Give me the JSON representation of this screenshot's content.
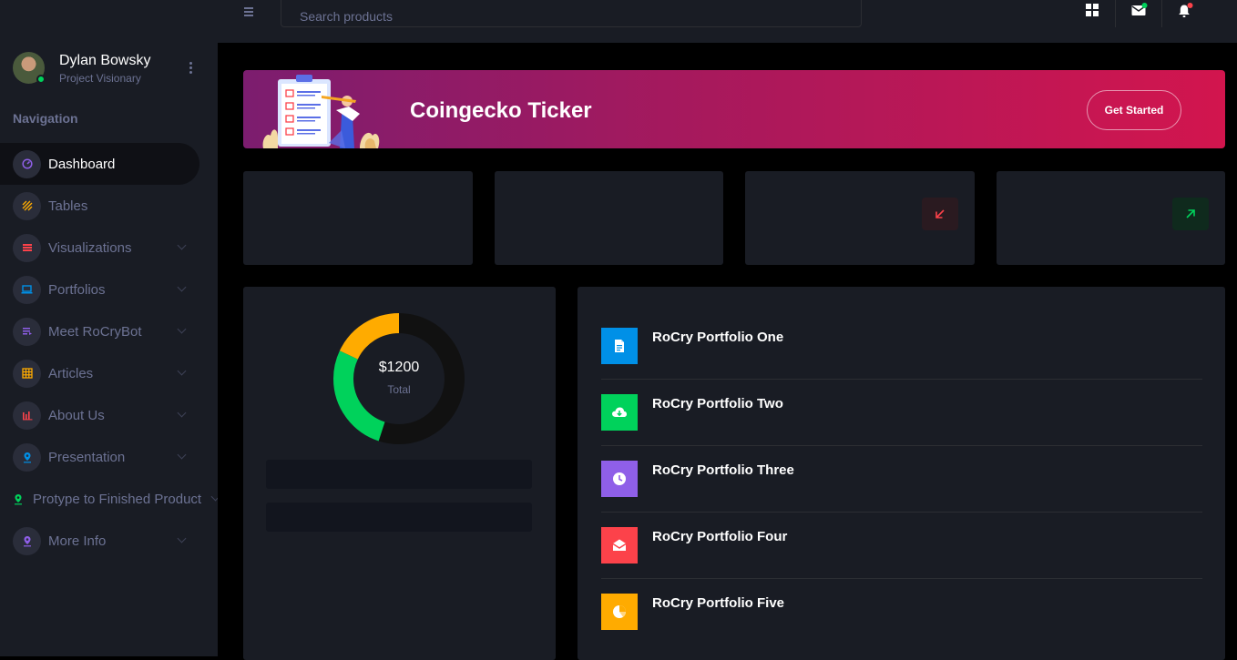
{
  "profile": {
    "name": "Dylan Bowsky",
    "role": "Project Visionary"
  },
  "navigation": {
    "title": "Navigation",
    "items": [
      {
        "label": "Dashboard",
        "icon": "speedometer-icon",
        "color": "#8f5fe8",
        "active": true,
        "has_submenu": false
      },
      {
        "label": "Tables",
        "icon": "table-stripes-icon",
        "color": "#ffab00",
        "active": false,
        "has_submenu": false
      },
      {
        "label": "Visualizations",
        "icon": "chart-list-icon",
        "color": "#fc424a",
        "active": false,
        "has_submenu": true
      },
      {
        "label": "Portfolios",
        "icon": "laptop-icon",
        "color": "#0090e7",
        "active": false,
        "has_submenu": true
      },
      {
        "label": "Meet RoCryBot",
        "icon": "playlist-icon",
        "color": "#8f5fe8",
        "active": false,
        "has_submenu": true
      },
      {
        "label": "Articles",
        "icon": "grid-table-icon",
        "color": "#ffab00",
        "active": false,
        "has_submenu": true
      },
      {
        "label": "About Us",
        "icon": "bar-chart-icon",
        "color": "#fc424a",
        "active": false,
        "has_submenu": true
      },
      {
        "label": "Presentation",
        "icon": "map-pin-icon",
        "color": "#0090e7",
        "active": false,
        "has_submenu": true
      },
      {
        "label": "Protype to Finished Product",
        "icon": "map-pin-icon",
        "color": "#00d25b",
        "active": false,
        "has_submenu": true
      },
      {
        "label": "More Info",
        "icon": "map-pin-icon",
        "color": "#8f5fe8",
        "active": false,
        "has_submenu": true
      }
    ]
  },
  "topbar": {
    "search_placeholder": "Search products",
    "icons": [
      "menu-icon",
      "grid-icon",
      "mail-icon",
      "bell-icon"
    ],
    "mail_indicator_color": "#00d25b",
    "bell_indicator_color": "#fc424a"
  },
  "banner": {
    "title": "Coingecko Ticker",
    "button": "Get Started"
  },
  "stat_cards": [
    {
      "arrow": ""
    },
    {
      "arrow": ""
    },
    {
      "arrow": "arrow-down-left-icon",
      "arrow_color": "#fc424a"
    },
    {
      "arrow": "arrow-up-right-icon",
      "arrow_color": "#00d25b"
    }
  ],
  "donut": {
    "total": "$1200",
    "label": "Total",
    "segments": [
      {
        "color": "#111111",
        "fraction": 0.55
      },
      {
        "color": "#00d25b",
        "fraction": 0.27
      },
      {
        "color": "#ffab00",
        "fraction": 0.18
      }
    ]
  },
  "portfolios": [
    {
      "label": "RoCry Portfolio One",
      "icon": "file-icon",
      "color": "#0090e7"
    },
    {
      "label": "RoCry Portfolio Two",
      "icon": "cloud-download-icon",
      "color": "#00d25b"
    },
    {
      "label": "RoCry Portfolio Three",
      "icon": "clock-icon",
      "color": "#8f5fe8"
    },
    {
      "label": "RoCry Portfolio Four",
      "icon": "open-mail-icon",
      "color": "#fc424a"
    },
    {
      "label": "RoCry Portfolio Five",
      "icon": "pie-chart-icon",
      "color": "#ffab00"
    }
  ]
}
